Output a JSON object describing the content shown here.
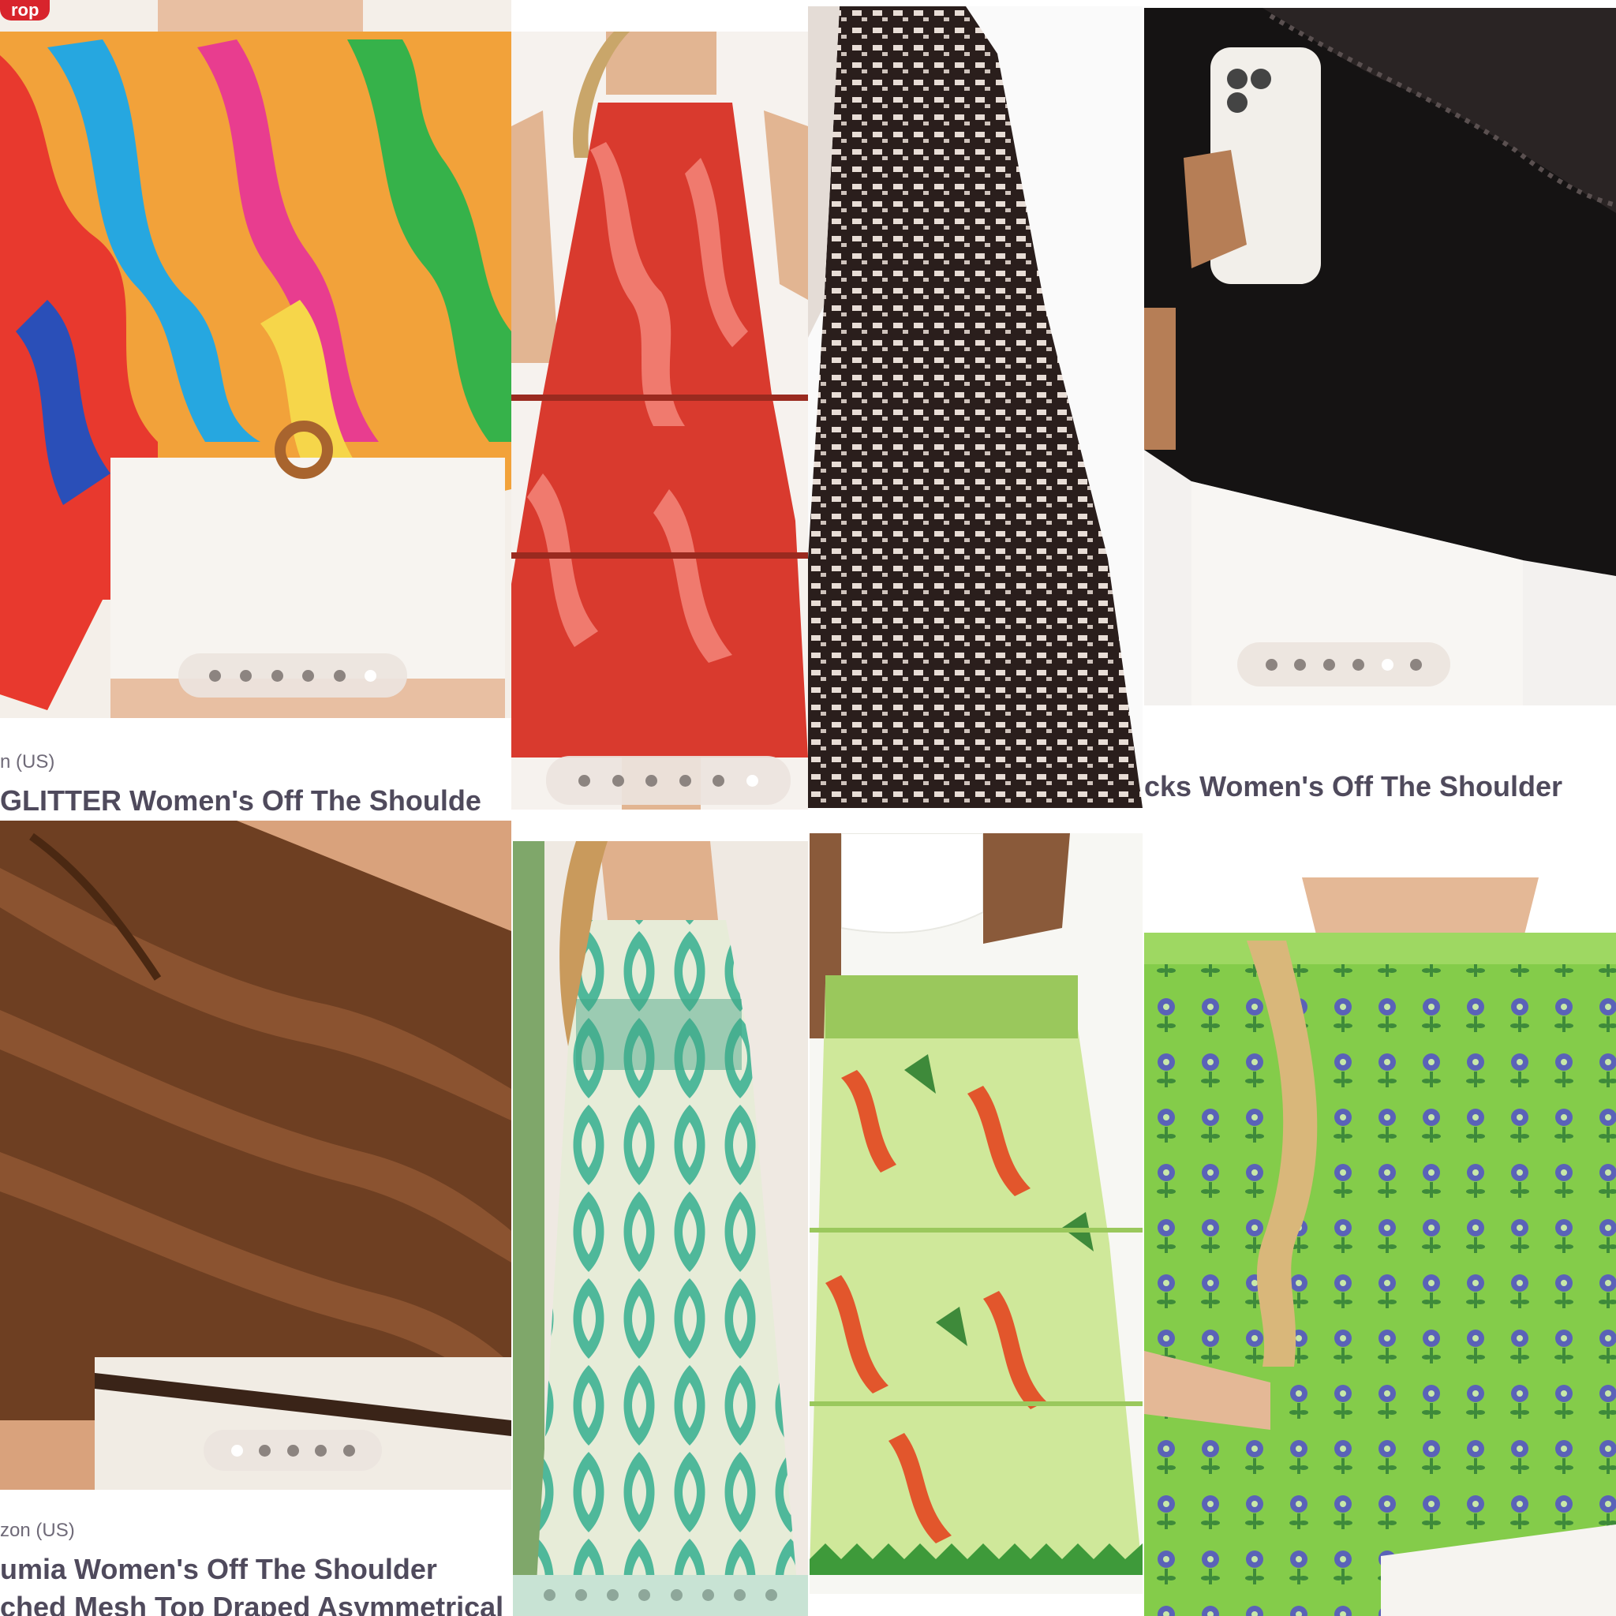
{
  "colors": {
    "page_bg": "#ffffff",
    "title_text": "#4f4a5c",
    "meta_text": "#6f6a78",
    "badge_red": "#d8242c",
    "dots_pill": "#ebe4de"
  },
  "cards": [
    {
      "id": "colorful-swirl-top",
      "badge": "rop",
      "seller": "n (US)",
      "title": "GLITTER Women's Off The Shoulde",
      "dots_total": 6,
      "dots_active": 6
    },
    {
      "id": "red-floral-dress",
      "dots_total": 6,
      "dots_active": 6
    },
    {
      "id": "polka-dot-dress"
    },
    {
      "id": "black-lace-top",
      "title": "cks Women's Off The Shoulder",
      "dots_total": 6,
      "dots_active": 5
    },
    {
      "id": "brown-mesh-top",
      "seller": "zon (US)",
      "title": "umia Women's Off The Shoulder",
      "title_line2": "ched Mesh Top Draped Asymmetrical",
      "dots_total": 5,
      "dots_active": 1
    },
    {
      "id": "green-ikat-dress",
      "dots_total": 8,
      "dots_active": 0
    },
    {
      "id": "green-parrot-skirt"
    },
    {
      "id": "green-floral-top"
    }
  ]
}
